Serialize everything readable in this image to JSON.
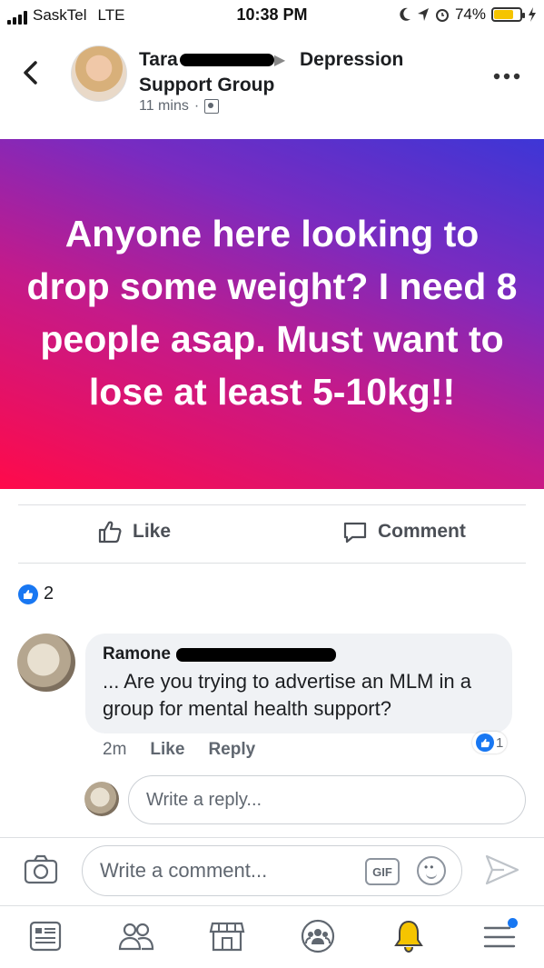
{
  "status_bar": {
    "carrier": "SaskTel",
    "network": "LTE",
    "time": "10:38 PM",
    "battery": "74%",
    "battery_level": 0.74
  },
  "header": {
    "author": "Tara",
    "group_name": "Depression",
    "group_name_2": "Support Group",
    "timestamp": "11 mins",
    "separator": "·"
  },
  "post": {
    "text": "Anyone here looking to drop some weight? I need 8 people asap. Must want to lose at least 5-10kg!!",
    "gradient_colors": [
      "#ff0a4a",
      "#c41a8a",
      "#7a2bc0",
      "#3d36d6"
    ]
  },
  "actions": {
    "like_label": "Like",
    "comment_label": "Comment"
  },
  "reactions": {
    "count": "2"
  },
  "comment": {
    "author": "Ramone",
    "text": "... Are you trying to advertise an MLM in a group for mental health support?",
    "time": "2m",
    "like_label": "Like",
    "reply_label": "Reply",
    "like_count": "1"
  },
  "reply_box": {
    "placeholder": "Write a reply..."
  },
  "comment_box": {
    "placeholder": "Write a comment...",
    "gif_label": "GIF"
  },
  "bottom_nav": [
    "news-feed-icon",
    "friends-icon",
    "marketplace-icon",
    "groups-icon",
    "notifications-icon",
    "menu-icon"
  ],
  "colors": {
    "accent": "#1877f2",
    "bell": "#f5c400"
  }
}
